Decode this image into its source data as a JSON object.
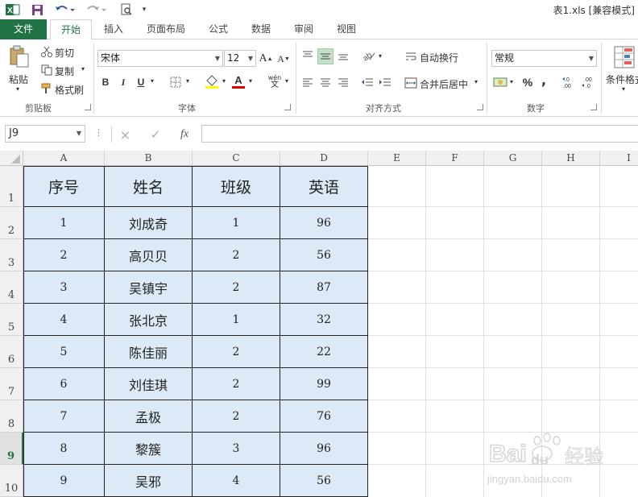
{
  "window": {
    "title": "表1.xls  [兼容模式]"
  },
  "quick_access": {
    "app_icon": "excel-icon",
    "save_icon": "save-icon",
    "undo_icon": "undo-icon",
    "redo_icon": "redo-icon",
    "preview_icon": "print-preview-icon"
  },
  "tabs": [
    {
      "label": "文件"
    },
    {
      "label": "开始"
    },
    {
      "label": "插入"
    },
    {
      "label": "页面布局"
    },
    {
      "label": "公式"
    },
    {
      "label": "数据"
    },
    {
      "label": "审阅"
    },
    {
      "label": "视图"
    }
  ],
  "ribbon": {
    "clipboard": {
      "group_label": "剪贴板",
      "paste_label": "粘贴",
      "cut_label": "剪切",
      "copy_label": "复制",
      "format_painter_label": "格式刷"
    },
    "font": {
      "group_label": "字体",
      "font_name": "宋体",
      "font_size": "12",
      "grow_label": "A",
      "shrink_label": "A",
      "bold_label": "B",
      "italic_label": "I",
      "underline_label": "U",
      "font_color_label": "A",
      "phonetic_label": "wén"
    },
    "alignment": {
      "group_label": "对齐方式",
      "wrap_label": "自动换行",
      "merge_label": "合并后居中"
    },
    "number": {
      "group_label": "数字",
      "format_value": "常规",
      "percent_label": "%",
      "comma_label": ","
    },
    "styles": {
      "conditional_label": "条件格式"
    },
    "accent_color": "#217346"
  },
  "formula_bar": {
    "name_box": "J9",
    "cancel_icon": "×",
    "enter_icon": "✓",
    "fx_label": "fx",
    "formula": ""
  },
  "sheet": {
    "columns": [
      "A",
      "B",
      "C",
      "D",
      "E",
      "F",
      "G",
      "H",
      "I"
    ],
    "rows": [
      "1",
      "2",
      "3",
      "4",
      "5",
      "6",
      "7",
      "8",
      "9",
      "10"
    ],
    "selected_row": "9",
    "header_row": [
      "序号",
      "姓名",
      "班级",
      "英语"
    ],
    "data": [
      [
        "1",
        "刘成奇",
        "1",
        "96"
      ],
      [
        "2",
        "高贝贝",
        "2",
        "56"
      ],
      [
        "3",
        "吴镇宇",
        "2",
        "87"
      ],
      [
        "4",
        "张北京",
        "1",
        "32"
      ],
      [
        "5",
        "陈佳丽",
        "2",
        "22"
      ],
      [
        "6",
        "刘佳琪",
        "2",
        "99"
      ],
      [
        "7",
        "孟极",
        "2",
        "76"
      ],
      [
        "8",
        "黎簇",
        "3",
        "96"
      ],
      [
        "9",
        "吴邪",
        "4",
        "56"
      ]
    ],
    "fill_color": "#dce9f6"
  },
  "watermark": {
    "brand": "Bai",
    "brand_suffix": "du",
    "cn": "经验",
    "url": "jingyan.baidu.com"
  }
}
